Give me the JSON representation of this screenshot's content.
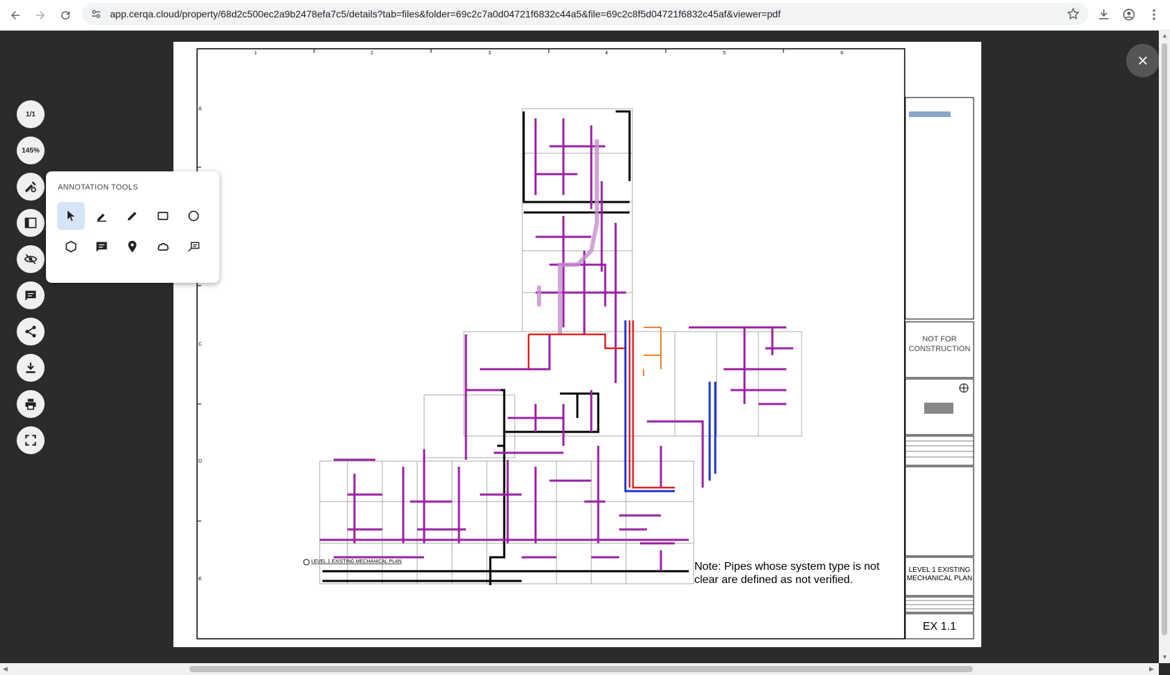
{
  "browser": {
    "url": "app.cerqa.cloud/property/68d2c500ec2a9b2478efa7c5/details?tab=files&folder=69c2c7a0d04721f6832c44a5&file=69c2c8f5d04721f6832c45af&viewer=pdf"
  },
  "toolbar": {
    "page_indicator": "1/1",
    "zoom": "145%"
  },
  "annotation_panel": {
    "title": "ANNOTATION TOOLS",
    "tools": [
      "select",
      "highlighter",
      "pen",
      "rectangle",
      "ellipse",
      "polygon",
      "comment",
      "pin",
      "cloud",
      "callout"
    ],
    "active_tool": "select"
  },
  "drawing": {
    "plan_label": "LEVEL 1 EXISTING MECHANICAL PLAN",
    "note_line1": "Note: Pipes whose system type is not",
    "note_line2": "clear are defined as not verified.",
    "stamp_line1": "NOT FOR",
    "stamp_line2": "CONSTRUCTION",
    "sheet_title_line1": "LEVEL 1 EXISTING",
    "sheet_title_line2": "MECHANICAL PLAN",
    "sheet_number": "EX 1.1",
    "grid_numbers": [
      "1",
      "2",
      "3",
      "4",
      "5",
      "6"
    ],
    "grid_letters": [
      "A",
      "B",
      "C",
      "D",
      "E"
    ]
  },
  "colors": {
    "magenta_duct": "#9b1fa3",
    "red_pipe": "#e02020",
    "blue_pipe": "#2030d0",
    "orange_pipe": "#f08030"
  }
}
